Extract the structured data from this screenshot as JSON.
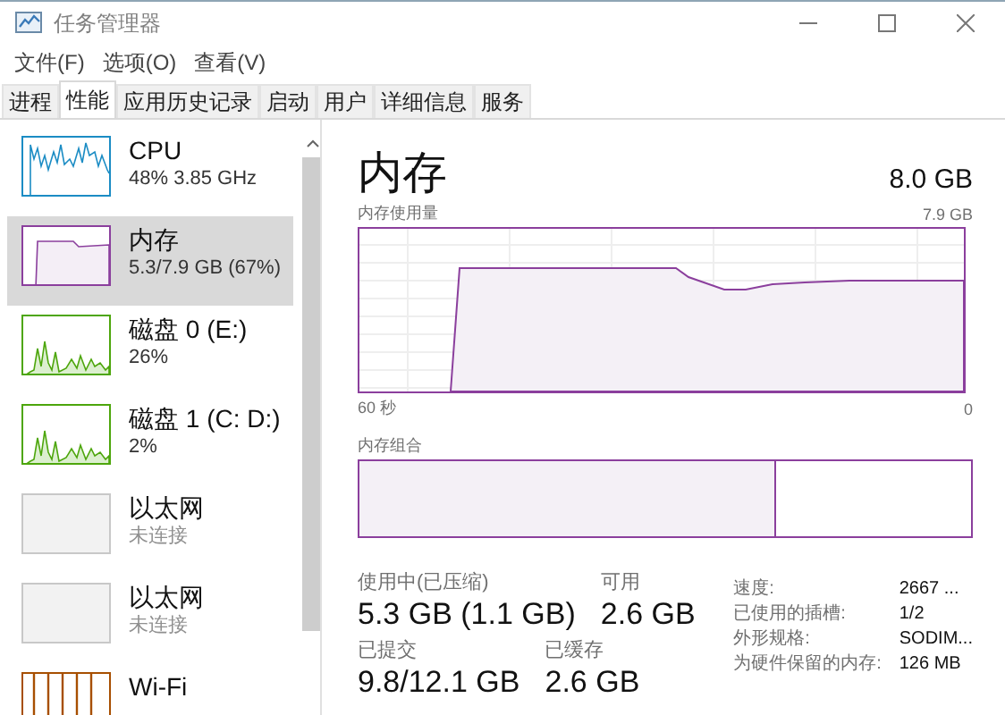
{
  "window": {
    "title": "任务管理器"
  },
  "menu": [
    "文件(F)",
    "选项(O)",
    "查看(V)"
  ],
  "tabs": [
    {
      "label": "进程",
      "selected": false
    },
    {
      "label": "性能",
      "selected": true
    },
    {
      "label": "应用历史记录",
      "selected": false
    },
    {
      "label": "启动",
      "selected": false
    },
    {
      "label": "用户",
      "selected": false
    },
    {
      "label": "详细信息",
      "selected": false
    },
    {
      "label": "服务",
      "selected": false
    }
  ],
  "sidebar": {
    "items": [
      {
        "kind": "cpu",
        "title": "CPU",
        "subtitle": "48% 3.85 GHz",
        "color": "#1b8cc4",
        "connected": true,
        "selected": false
      },
      {
        "kind": "memory",
        "title": "内存",
        "subtitle": "5.3/7.9 GB (67%)",
        "color": "#8b3f9d",
        "connected": true,
        "selected": true
      },
      {
        "kind": "disk",
        "title": "磁盘 0 (E:)",
        "subtitle": "26%",
        "color": "#4da60c",
        "connected": true,
        "selected": false
      },
      {
        "kind": "disk",
        "title": "磁盘 1 (C: D:)",
        "subtitle": "2%",
        "color": "#4da60c",
        "connected": true,
        "selected": false
      },
      {
        "kind": "network",
        "title": "以太网",
        "subtitle": "未连接",
        "color": "#c8c8c8",
        "connected": false,
        "selected": false
      },
      {
        "kind": "network",
        "title": "以太网",
        "subtitle": "未连接",
        "color": "#c8c8c8",
        "connected": false,
        "selected": false
      },
      {
        "kind": "wifi",
        "title": "Wi-Fi",
        "color": "#a74f01",
        "connected": true,
        "selected": false
      }
    ]
  },
  "detail": {
    "title": "内存",
    "total": "8.0 GB",
    "graph_label": "内存使用量",
    "graph_max": "7.9 GB",
    "time_start": "60 秒",
    "time_end": "0",
    "composition_label": "内存组合",
    "composition": {
      "level": 0.68
    },
    "stat_rows": [
      {
        "items": [
          {
            "label": "使用中(已压缩)",
            "value": "5.3 GB (1.1 GB)"
          },
          {
            "label": "可用",
            "value": "2.6 GB"
          }
        ]
      },
      {
        "items": [
          {
            "label": "已提交",
            "value": "9.8/12.1 GB"
          },
          {
            "label": "已缓存",
            "value": "2.6 GB"
          }
        ]
      }
    ],
    "details": [
      {
        "label": "速度:",
        "value": "2667 ..."
      },
      {
        "label": "已使用的插槽:",
        "value": "1/2"
      },
      {
        "label": "外形规格:",
        "value": "SODIM..."
      },
      {
        "label": "为硬件保留的内存:",
        "value": "126 MB"
      }
    ]
  }
}
